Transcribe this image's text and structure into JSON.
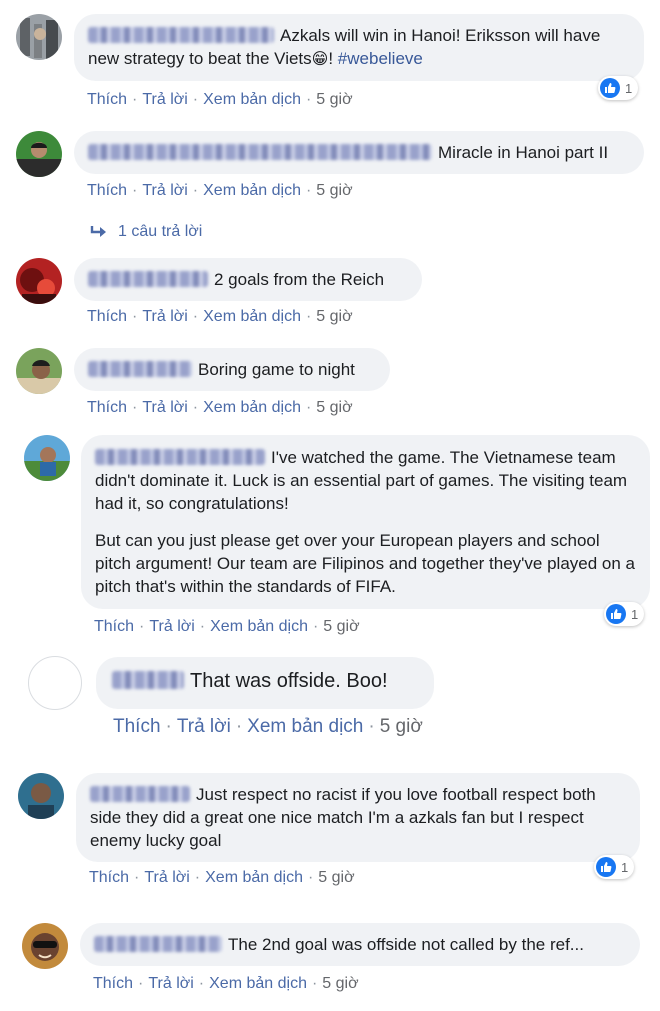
{
  "actions": {
    "like": "Thích",
    "reply": "Trả lời",
    "translate": "Xem bản dịch",
    "separator": "·"
  },
  "comments": [
    {
      "text": "Azkals will win in Hanoi! Eriksson will have new strategy to beat the Viets",
      "emoji": "😁",
      "after_emoji": "! ",
      "hashtag": "#webelieve",
      "time": "5 giờ",
      "likes": "1"
    },
    {
      "text": "Miracle in Hanoi part II",
      "time": "5 giờ",
      "replies_label": "1 câu trả lời"
    },
    {
      "text": "2 goals from the Reich",
      "time": "5 giờ"
    },
    {
      "text": "Boring game to night",
      "time": "5 giờ"
    },
    {
      "text": "I've watched the game. The Vietnamese team didn't dominate it. Luck is an essential part of games. The visiting team had it, so congratulations!",
      "text2": "But can you just please get over your European players and school pitch argument! Our team are Filipinos and together they've played on a pitch that's within the standards of FIFA.",
      "time": "5 giờ",
      "likes": "1"
    },
    {
      "text": "That was offside. Boo!",
      "time": "5 giờ"
    },
    {
      "text": "Just respect no racist if you love football respect both side they did a great one nice match I'm a azkals fan but I respect enemy lucky goal",
      "time": "5 giờ",
      "likes": "1"
    },
    {
      "text": "The 2nd goal was offside not called by the ref...",
      "time": "5 giờ"
    }
  ]
}
